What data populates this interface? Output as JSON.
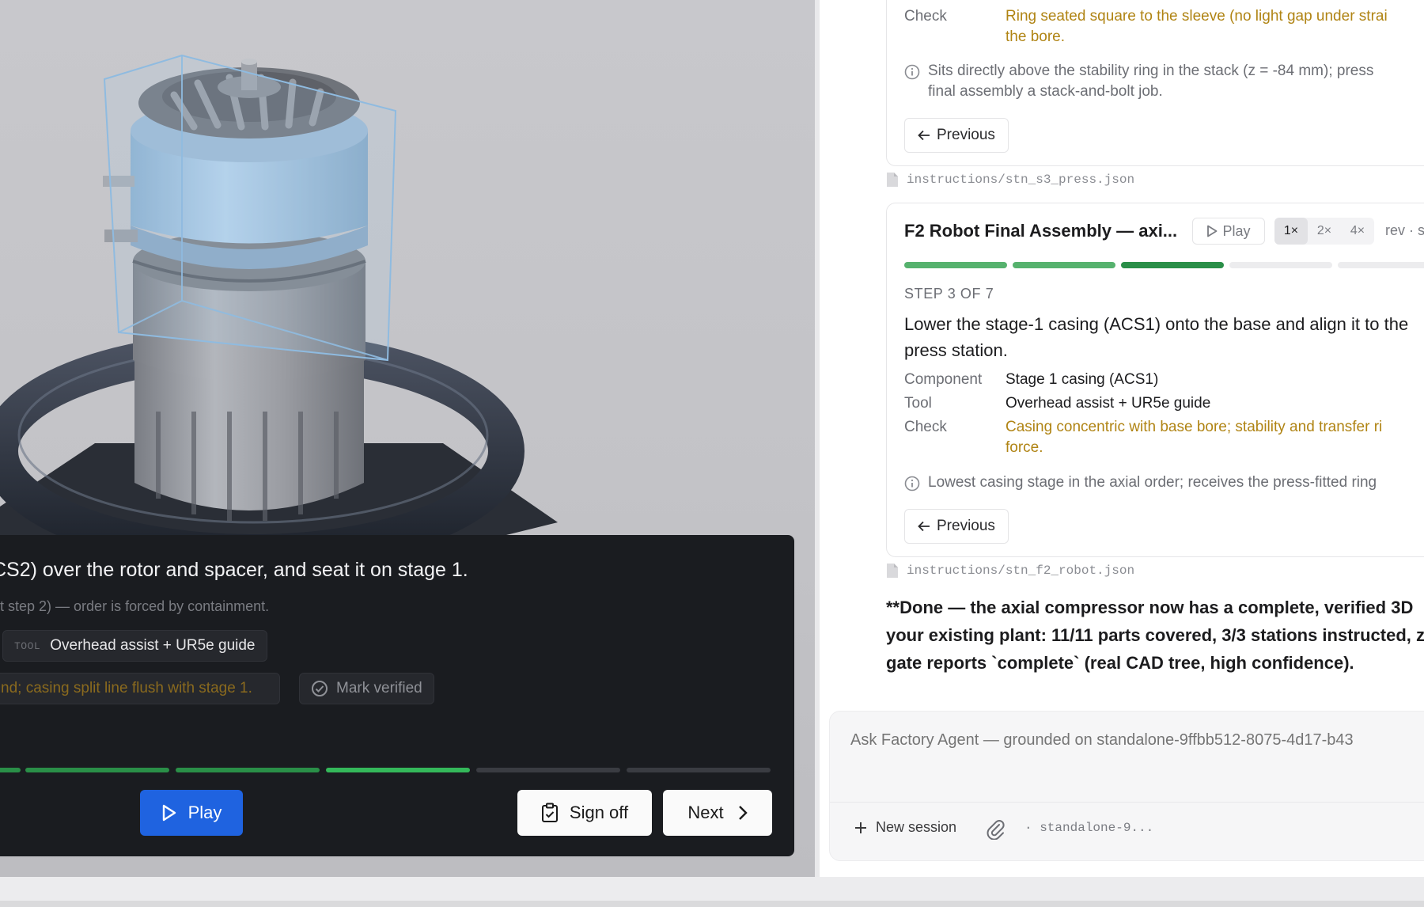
{
  "viewer": {
    "step_text": "CS2) over the rotor and spacer, and seat it on stage 1.",
    "note": "at step 2) — order is forced by containment.",
    "tool_key": "TOOL",
    "tool_value": "Overhead assist + UR5e guide",
    "check_value": "nd; casing split line flush with stage 1.",
    "mark_verified": "Mark verified",
    "play": "Play",
    "sign_off": "Sign off",
    "next": "Next",
    "progress": {
      "total": 7,
      "completed": 3,
      "current": 4
    }
  },
  "chat": {
    "card1": {
      "check_key": "Check",
      "check_value": "Ring seated square to the sleeve (no light gap under straight edge) and flush with the bore.",
      "check_line1": "Ring seated square to the sleeve (no light gap under strai",
      "check_line2": "the bore.",
      "note_line1": "Sits directly above the stability ring in the stack (z = -84 mm); press",
      "note_line2": "final assembly a stack-and-bolt job.",
      "previous": "Previous"
    },
    "file1": "instructions/stn_s3_press.json",
    "card2": {
      "title": "F2 Robot Final Assembly — axi...",
      "play": "Play",
      "speeds": [
        "1×",
        "2×",
        "4×"
      ],
      "speed_selected": "1×",
      "rev": "rev · s",
      "progress": {
        "total": 7,
        "completed": 2,
        "current": 3
      },
      "step_label": "STEP 3 OF 7",
      "step_text": "Lower the stage-1 casing (ACS1) onto the base and align it to the press station.",
      "component_key": "Component",
      "component_value": "Stage 1 casing (ACS1)",
      "tool_key": "Tool",
      "tool_value": "Overhead assist + UR5e guide",
      "check_key": "Check",
      "check_line1": "Casing concentric with base bore; stability and transfer ri",
      "check_line2": "force.",
      "note": "Lowest casing stage in the axial order; receives the press-fitted ring",
      "previous": "Previous"
    },
    "file2": "instructions/stn_f2_robot.json",
    "done_message": "**Done — the axial compressor now has a complete, verified 3D your existing plant: 11/11 parts covered, 3/3 stations instructed, z gate reports `complete` (real CAD tree, high confidence).",
    "composer": {
      "placeholder": "Ask Factory Agent — grounded on standalone-9ffbb512-8075-4d17-b43",
      "new_session": "New session",
      "session_id": "· standalone-9..."
    }
  },
  "colors": {
    "accent_blue": "#1f63e0",
    "progress_green": "#2a8f48",
    "warning_amber": "#b08414",
    "overlay_bg": "#1a1c20"
  },
  "icons": [
    "play-icon",
    "clipboard-check-icon",
    "chevron-right-icon",
    "check-circle-icon",
    "arrow-left-icon",
    "info-icon",
    "file-icon",
    "plus-icon",
    "paperclip-icon"
  ]
}
